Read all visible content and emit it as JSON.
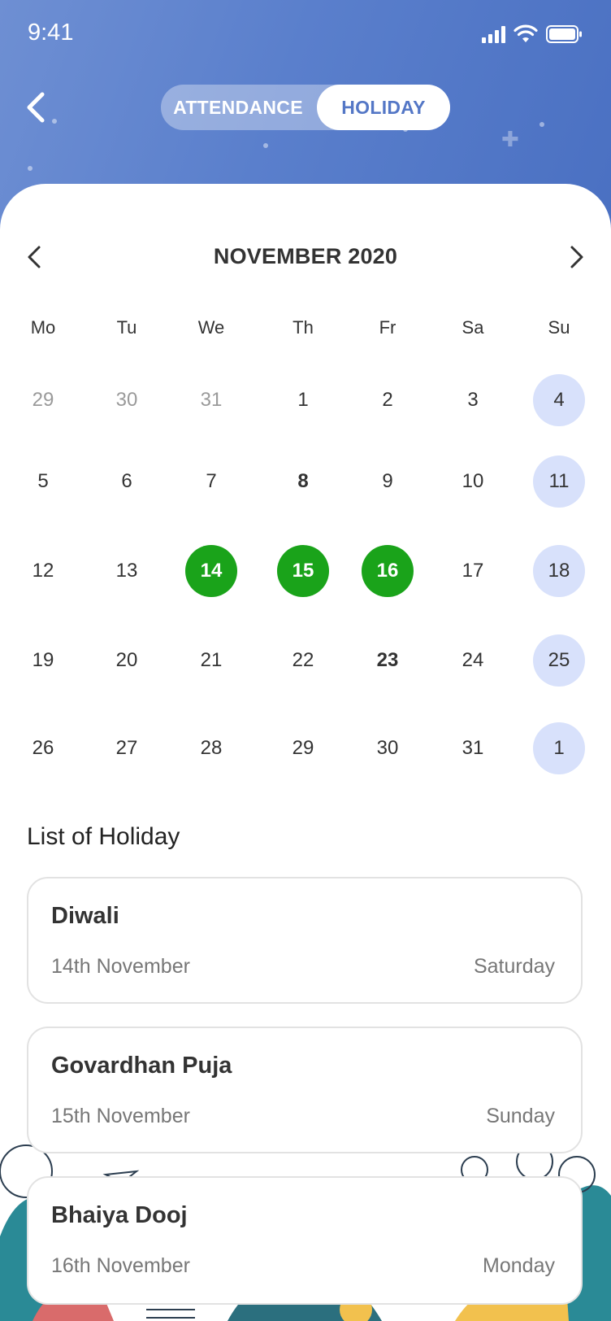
{
  "status_bar": {
    "time": "9:41"
  },
  "header": {
    "tabs": [
      {
        "label": "ATTENDANCE",
        "active": false
      },
      {
        "label": "HOLIDAY",
        "active": true
      }
    ]
  },
  "calendar": {
    "month_label": "NOVEMBER 2020",
    "weekdays": [
      "Mo",
      "Tu",
      "We",
      "Th",
      "Fr",
      "Sa",
      "Su"
    ],
    "weeks": [
      [
        "29",
        "30",
        "31",
        "1",
        "2",
        "3",
        "4"
      ],
      [
        "5",
        "6",
        "7",
        "8",
        "9",
        "10",
        "11"
      ],
      [
        "12",
        "13",
        "14",
        "15",
        "16",
        "17",
        "18"
      ],
      [
        "19",
        "20",
        "21",
        "22",
        "23",
        "24",
        "25"
      ],
      [
        "26",
        "27",
        "28",
        "29",
        "30",
        "31",
        "1"
      ]
    ],
    "holiday_dates": [
      "14",
      "15",
      "16"
    ],
    "bold_dates": [
      "8",
      "23"
    ],
    "outside_month_cells": 3
  },
  "holiday_list": {
    "title": "List of Holiday",
    "items": [
      {
        "name": "Diwali",
        "date": "14th November",
        "weekday": "Saturday"
      },
      {
        "name": "Govardhan Puja",
        "date": "15th November",
        "weekday": "Sunday"
      },
      {
        "name": "Bhaiya Dooj",
        "date": "16th November",
        "weekday": "Monday"
      }
    ]
  },
  "colors": {
    "header_gradient_start": "#6e8fd3",
    "header_gradient_end": "#4a70c2",
    "holiday_green": "#1aa31a",
    "sunday_highlight": "#d8e1fb",
    "active_tab_text": "#5477c6"
  }
}
